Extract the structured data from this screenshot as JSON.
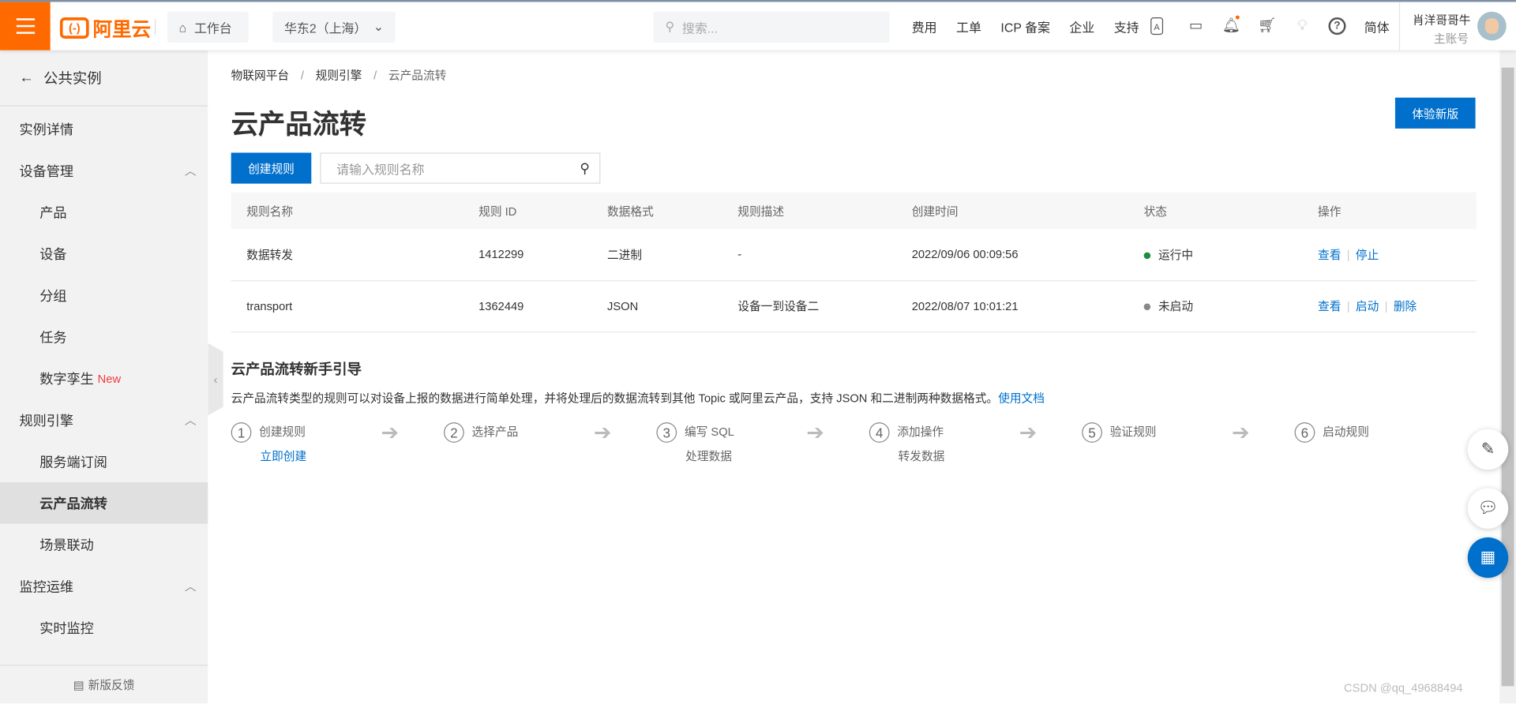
{
  "header": {
    "logo": "阿里云",
    "workbench": "工作台",
    "region": "华东2（上海）",
    "search_placeholder": "搜索...",
    "nav": [
      "费用",
      "工单",
      "ICP 备案",
      "企业",
      "支持"
    ],
    "lang": "简体",
    "user_name": "肖洋哥哥牛",
    "user_role": "主账号"
  },
  "sidebar": {
    "back": "公共实例",
    "items": [
      {
        "label": "实例详情",
        "level": 1
      },
      {
        "label": "设备管理",
        "level": 1,
        "chev": "^"
      },
      {
        "label": "产品",
        "level": 2
      },
      {
        "label": "设备",
        "level": 2
      },
      {
        "label": "分组",
        "level": 2
      },
      {
        "label": "任务",
        "level": 2
      },
      {
        "label": "数字孪生",
        "level": 2,
        "badge": "New"
      },
      {
        "label": "规则引擎",
        "level": 1,
        "chev": "^"
      },
      {
        "label": "服务端订阅",
        "level": 2
      },
      {
        "label": "云产品流转",
        "level": 2,
        "active": true
      },
      {
        "label": "场景联动",
        "level": 2
      },
      {
        "label": "监控运维",
        "level": 1,
        "chev": "^"
      },
      {
        "label": "实时监控",
        "level": 2
      }
    ],
    "feedback": "新版反馈"
  },
  "main": {
    "breadcrumb": [
      "物联网平台",
      "规则引擎",
      "云产品流转"
    ],
    "title": "云产品流转",
    "try_new": "体验新版",
    "create": "创建规则",
    "search_placeholder": "请输入规则名称",
    "columns": [
      "规则名称",
      "规则 ID",
      "数据格式",
      "规则描述",
      "创建时间",
      "状态",
      "操作"
    ],
    "rows": [
      {
        "name": "数据转发",
        "id": "1412299",
        "format": "二进制",
        "desc": "-",
        "time": "2022/09/06 00:09:56",
        "status": "运行中",
        "status_color": "#1e8e3e",
        "actions": [
          "查看",
          "停止"
        ]
      },
      {
        "name": "transport",
        "id": "1362449",
        "format": "JSON",
        "desc": "设备一到设备二",
        "time": "2022/08/07 10:01:21",
        "status": "未启动",
        "status_color": "#888888",
        "actions": [
          "查看",
          "启动",
          "删除"
        ]
      }
    ],
    "guide_title": "云产品流转新手引导",
    "guide_desc": "云产品流转类型的规则可以对设备上报的数据进行简单处理，并将处理后的数据流转到其他 Topic 或阿里云产品，支持 JSON 和二进制两种数据格式。",
    "guide_link": "使用文档",
    "steps": [
      {
        "n": "1",
        "label": "创建规则",
        "sub": "立即创建",
        "link": true
      },
      {
        "n": "2",
        "label": "选择产品"
      },
      {
        "n": "3",
        "label": "编写 SQL",
        "sub": "处理数据"
      },
      {
        "n": "4",
        "label": "添加操作",
        "sub": "转发数据"
      },
      {
        "n": "5",
        "label": "验证规则"
      },
      {
        "n": "6",
        "label": "启动规则"
      }
    ]
  },
  "watermark": "CSDN @qq_49688494"
}
